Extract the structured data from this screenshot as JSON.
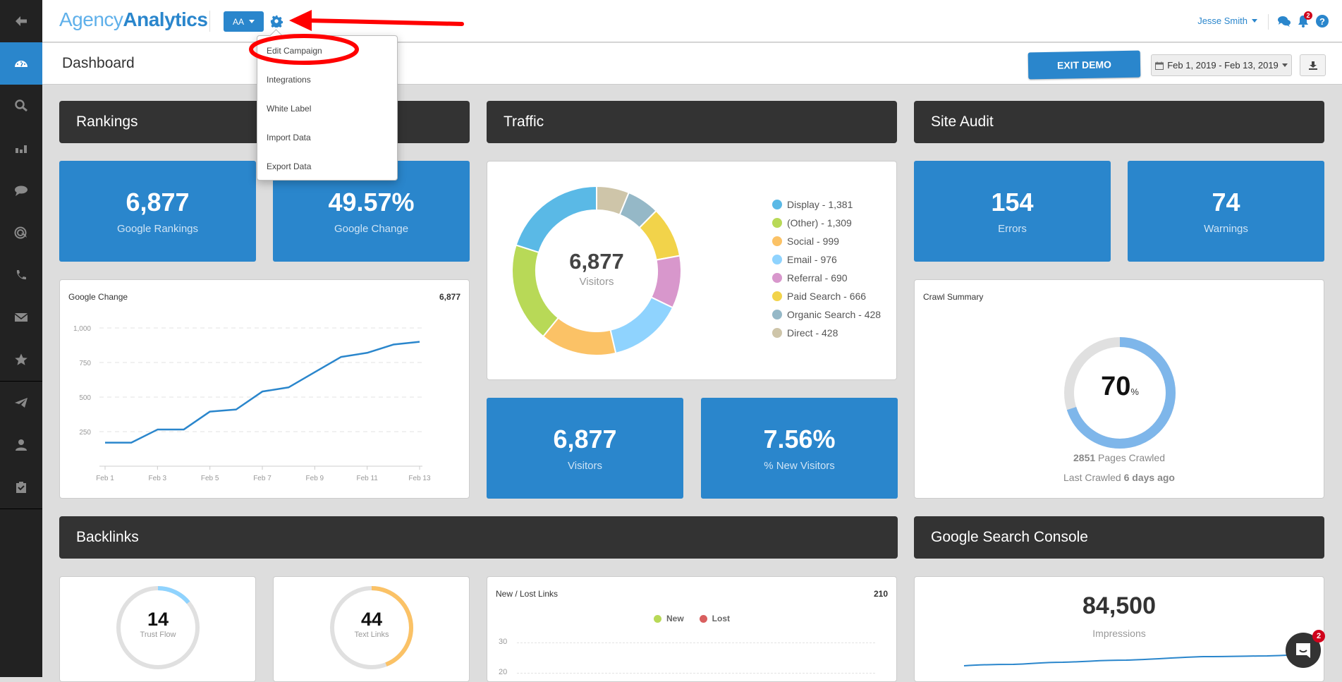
{
  "sidebar": {
    "items": [
      {
        "name": "back",
        "icon": "arrow-left-icon"
      },
      {
        "name": "dashboard",
        "icon": "dashboard-gauge-icon",
        "active": true
      },
      {
        "name": "seo",
        "icon": "search-icon"
      },
      {
        "name": "analytics",
        "icon": "bar-chart-icon"
      },
      {
        "name": "social",
        "icon": "comment-icon"
      },
      {
        "name": "ppc",
        "icon": "target-icon"
      },
      {
        "name": "calls",
        "icon": "phone-icon"
      },
      {
        "name": "email",
        "icon": "envelope-icon"
      },
      {
        "name": "reviews",
        "icon": "star-icon"
      },
      {
        "name": "reports",
        "icon": "paper-plane-icon"
      },
      {
        "name": "users",
        "icon": "user-icon"
      },
      {
        "name": "tasks",
        "icon": "clipboard-check-icon"
      }
    ]
  },
  "header": {
    "logo_light": "Agency",
    "logo_bold": "Analytics",
    "campaign_button": "AA",
    "user_name": "Jesse Smith",
    "notification_count": "2"
  },
  "settings_menu": {
    "items": [
      "Edit Campaign",
      "Integrations",
      "White Label",
      "Import Data",
      "Export Data"
    ]
  },
  "subheader": {
    "title": "Dashboard",
    "exit_demo": "EXIT DEMO",
    "date_range": "Feb 1, 2019 - Feb 13, 2019"
  },
  "rankings": {
    "title": "Rankings",
    "tiles": [
      {
        "value": "6,877",
        "label": "Google Rankings"
      },
      {
        "value": "49.57%",
        "label": "Google Change"
      }
    ],
    "chart_card": {
      "title": "Google Change",
      "total": "6,877"
    }
  },
  "traffic": {
    "title": "Traffic",
    "donut_center_value": "6,877",
    "donut_center_label": "Visitors",
    "legend": [
      {
        "label": "Display - 1,381",
        "color": "#5ab9e6"
      },
      {
        "label": "(Other) - 1,309",
        "color": "#b8d957"
      },
      {
        "label": "Social - 999",
        "color": "#fbc266"
      },
      {
        "label": "Email - 976",
        "color": "#8fd3fe"
      },
      {
        "label": "Referral - 690",
        "color": "#d897cc"
      },
      {
        "label": "Paid Search - 666",
        "color": "#f2d34a"
      },
      {
        "label": "Organic Search - 428",
        "color": "#95b8c7"
      },
      {
        "label": "Direct - 428",
        "color": "#cec5a9"
      }
    ],
    "tiles": [
      {
        "value": "6,877",
        "label": "Visitors"
      },
      {
        "value": "7.56%",
        "label": "% New Visitors"
      }
    ]
  },
  "site_audit": {
    "title": "Site Audit",
    "tiles": [
      {
        "value": "154",
        "label": "Errors"
      },
      {
        "value": "74",
        "label": "Warnings"
      }
    ],
    "crawl": {
      "title": "Crawl Summary",
      "percent_value": "70",
      "percent_sign": "%",
      "percent": 70,
      "pages_count": "2851",
      "pages_label": "Pages Crawled",
      "last_crawled_label": "Last Crawled",
      "last_crawled_value": "6 days ago"
    }
  },
  "backlinks": {
    "title": "Backlinks",
    "trust_flow": {
      "value": "14",
      "label": "Trust Flow",
      "fraction": 0.14,
      "color": "#8fd3fe"
    },
    "text_links": {
      "value": "44",
      "label": "Text Links",
      "fraction": 0.44,
      "color": "#fbc266"
    },
    "new_lost": {
      "title": "New / Lost Links",
      "total": "210",
      "legend": [
        {
          "label": "New",
          "color": "#b8d957"
        },
        {
          "label": "Lost",
          "color": "#d95f5f"
        }
      ],
      "y_ticks": [
        "30",
        "20"
      ]
    }
  },
  "gsc": {
    "title": "Google Search Console",
    "value": "84,500",
    "label": "Impressions"
  },
  "chat_widget": {
    "badge": "2"
  },
  "chart_data": [
    {
      "type": "line",
      "title": "Google Change",
      "x": [
        "Feb 1",
        "Feb 2",
        "Feb 3",
        "Feb 4",
        "Feb 5",
        "Feb 6",
        "Feb 7",
        "Feb 8",
        "Feb 9",
        "Feb 10",
        "Feb 11",
        "Feb 12",
        "Feb 13"
      ],
      "x_tick_labels": [
        "Feb 1",
        "Feb 3",
        "Feb 5",
        "Feb 7",
        "Feb 9",
        "Feb 11",
        "Feb 13"
      ],
      "series": [
        {
          "name": "Google Change",
          "values": [
            170,
            170,
            265,
            265,
            395,
            410,
            540,
            570,
            680,
            790,
            820,
            880,
            900
          ],
          "color": "#2a86cc"
        }
      ],
      "y_ticks": [
        "250",
        "500",
        "750",
        "1,000"
      ],
      "y_tick_values": [
        250,
        500,
        750,
        1000
      ],
      "ylim": [
        0,
        1000
      ],
      "grid": true
    },
    {
      "type": "pie",
      "title": "Traffic",
      "categories": [
        "Display",
        "(Other)",
        "Social",
        "Email",
        "Referral",
        "Paid Search",
        "Organic Search",
        "Direct"
      ],
      "values": [
        1381,
        1309,
        999,
        976,
        690,
        666,
        428,
        428
      ],
      "total": 6877
    }
  ]
}
